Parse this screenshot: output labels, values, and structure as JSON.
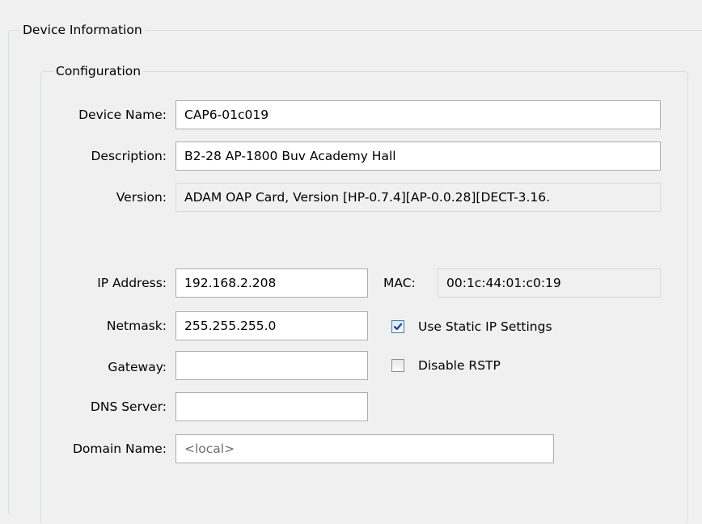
{
  "device_info": {
    "title": "Device Information",
    "configuration": {
      "title": "Configuration",
      "device_name": {
        "label": "Device Name:",
        "value": "CAP6-01c019"
      },
      "description": {
        "label": "Description:",
        "value": "B2-28 AP-1800 Buv Academy Hall"
      },
      "version": {
        "label": "Version:",
        "value": "ADAM OAP Card, Version [HP-0.7.4][AP-0.0.28][DECT-3.16."
      },
      "ip_address": {
        "label": "IP Address:",
        "value": "192.168.2.208"
      },
      "mac": {
        "label": "MAC:",
        "value": "00:1c:44:01:c0:19"
      },
      "netmask": {
        "label": "Netmask:",
        "value": "255.255.255.0"
      },
      "use_static_ip": {
        "label": "Use Static IP Settings",
        "checked": true
      },
      "gateway": {
        "label": "Gateway:",
        "value": ""
      },
      "disable_rstp": {
        "label": "Disable RSTP",
        "checked": false
      },
      "dns_server": {
        "label": "DNS Server:",
        "value": ""
      },
      "domain_name": {
        "label": "Domain Name:",
        "placeholder": "<local>"
      }
    }
  }
}
